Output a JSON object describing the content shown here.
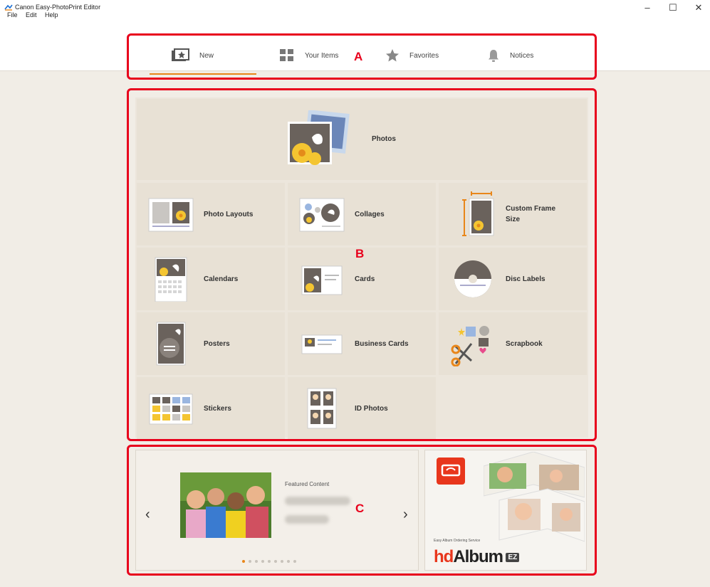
{
  "window": {
    "title": "Canon Easy-PhotoPrint Editor",
    "minimize_glyph": "–",
    "maximize_glyph": "☐",
    "close_glyph": "✕"
  },
  "menu": [
    "File",
    "Edit",
    "Help"
  ],
  "tabs": [
    {
      "label": "New",
      "icon": "new-icon",
      "selected": true
    },
    {
      "label": "Your Items",
      "icon": "grid-icon"
    },
    {
      "label": "Favorites",
      "icon": "star-icon"
    },
    {
      "label": "Notices",
      "icon": "bell-icon"
    }
  ],
  "photos_label": "Photos",
  "items": [
    {
      "label": "Photo Layouts",
      "icon": "photo-layouts-icon"
    },
    {
      "label": "Collages",
      "icon": "collages-icon"
    },
    {
      "label": "Custom Frame Size",
      "icon": "custom-frame-size-icon"
    },
    {
      "label": "Calendars",
      "icon": "calendars-icon"
    },
    {
      "label": "Cards",
      "icon": "cards-icon"
    },
    {
      "label": "Disc Labels",
      "icon": "disc-labels-icon"
    },
    {
      "label": "Posters",
      "icon": "posters-icon"
    },
    {
      "label": "Business Cards",
      "icon": "business-cards-icon"
    },
    {
      "label": "Scrapbook",
      "icon": "scrapbook-icon"
    },
    {
      "label": "Stickers",
      "icon": "stickers-icon"
    },
    {
      "label": "ID Photos",
      "icon": "id-photos-icon"
    }
  ],
  "featured": {
    "label": "Featured Content",
    "prev_glyph": "‹",
    "next_glyph": "›",
    "dot_count": 9,
    "active_dot": 1
  },
  "album_banner": {
    "tagline": "Easy Album Ordering Service",
    "brand_hd": "hd",
    "brand_album": "Album",
    "brand_ez": "EZ"
  },
  "annotations": [
    "A",
    "B",
    "C"
  ],
  "colors": {
    "accent": "#e8861a",
    "annotation_red": "#e8001c",
    "tile_bg": "#e8e1d5",
    "background": "#f1ede6"
  }
}
